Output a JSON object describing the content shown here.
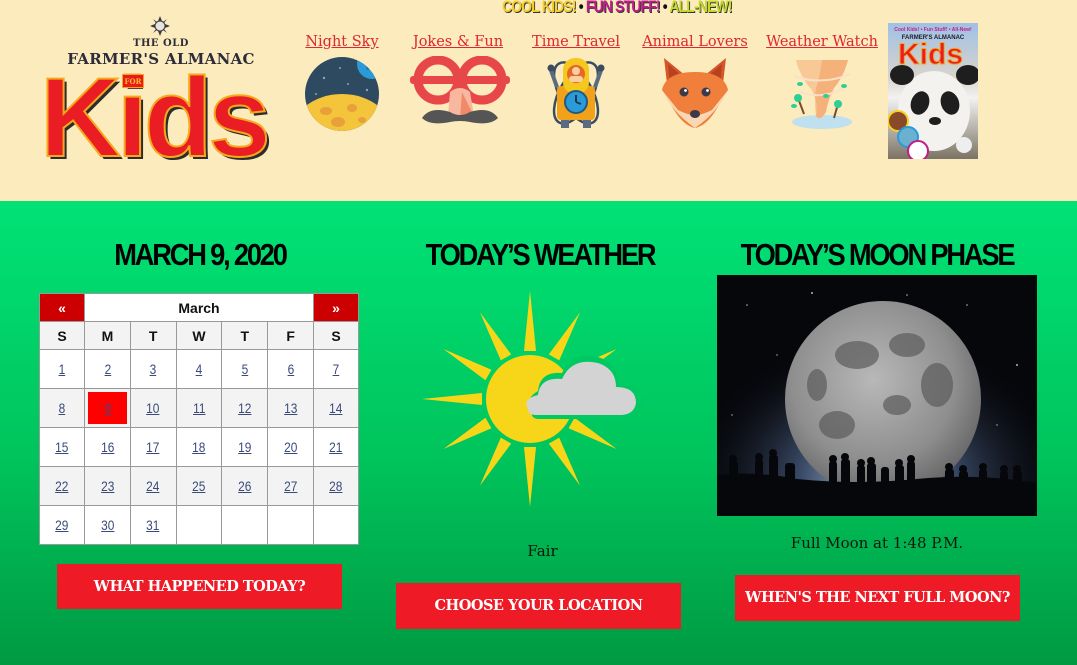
{
  "header": {
    "tagline": [
      "COOL KIDS!",
      "FUN STUFF!",
      "ALL-NEW!"
    ],
    "tagline_separator": "•",
    "logo": {
      "line1": "THE OLD",
      "line2": "FARMER'S ALMANAC",
      "for": "FOR",
      "kids": "Kids"
    },
    "nav": [
      {
        "label": "Night Sky",
        "icon": "moon-planet-icon"
      },
      {
        "label": "Jokes & Fun",
        "icon": "funny-glasses-icon"
      },
      {
        "label": "Time Travel",
        "icon": "time-machine-icon"
      },
      {
        "label": "Animal Lovers",
        "icon": "fox-icon"
      },
      {
        "label": "Weather Watch",
        "icon": "tornado-icon"
      }
    ],
    "cover": {
      "tagline": "Cool Kids! • Fun Stuff! • All-New!",
      "brand": "FARMER'S ALMANAC",
      "title": "Kids"
    }
  },
  "date_section": {
    "title": "MARCH 9, 2020",
    "calendar": {
      "prev_label": "«",
      "next_label": "»",
      "month": "March",
      "weekdays": [
        "S",
        "M",
        "T",
        "W",
        "T",
        "F",
        "S"
      ],
      "weeks": [
        [
          "1",
          "2",
          "3",
          "4",
          "5",
          "6",
          "7"
        ],
        [
          "8",
          "9",
          "10",
          "11",
          "12",
          "13",
          "14"
        ],
        [
          "15",
          "16",
          "17",
          "18",
          "19",
          "20",
          "21"
        ],
        [
          "22",
          "23",
          "24",
          "25",
          "26",
          "27",
          "28"
        ],
        [
          "29",
          "30",
          "31",
          "",
          "",
          "",
          ""
        ]
      ],
      "selected_day": "9"
    },
    "button": "WHAT HAPPENED TODAY?"
  },
  "weather_section": {
    "title": "TODAY’S WEATHER",
    "condition": "Fair",
    "icon": "partly-cloudy-icon",
    "button": "CHOOSE YOUR LOCATION"
  },
  "moon_section": {
    "title": "TODAY’S MOON PHASE",
    "phase_text": "Full Moon at 1:48 P.M.",
    "button": "WHEN'S THE NEXT FULL MOON?"
  },
  "colors": {
    "header_bg": "#fcebbc",
    "main_green": "#00e274",
    "accent_red": "#ee1b27",
    "link_red": "#e0262e",
    "calendar_red": "#cc0000"
  }
}
